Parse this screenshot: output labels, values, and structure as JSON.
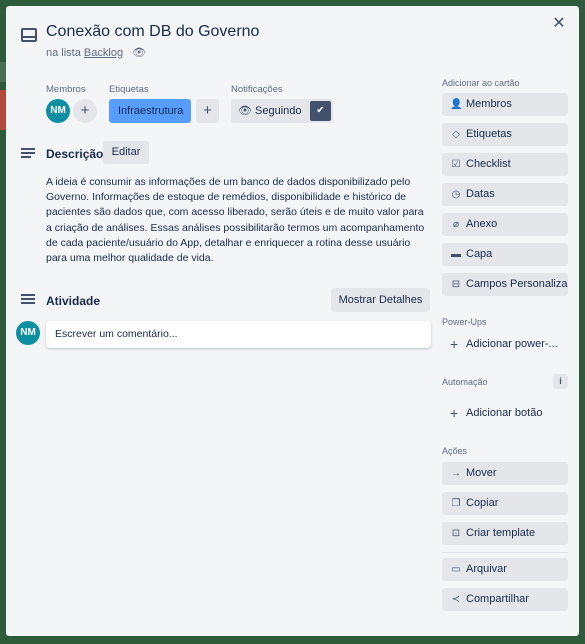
{
  "card": {
    "title": "Conexão com DB do Governo",
    "list_prefix": "na lista",
    "list_name": "Backlog"
  },
  "members": {
    "label": "Membros",
    "avatar_initials": "NM"
  },
  "labels": {
    "label": "Etiquetas",
    "chip": "Infraestrutura",
    "chip_color": "#579dff"
  },
  "notifications": {
    "label": "Notificações",
    "status": "Seguindo"
  },
  "description": {
    "title": "Descrição",
    "edit_label": "Editar",
    "text": "A ideia é consumir as informações de um banco de dados disponibilizado pelo Governo. Informações de estoque de remédios, disponibilidade e histórico de pacientes são dados que, com acesso liberado, serão úteis e de muito valor para a criação de análises. Essas análises possibilitarão termos um acompanhamento de cada paciente/usuário do App, detalhar e enriquecer a rotina desse usuário para uma melhor qualidade de vida."
  },
  "activity": {
    "title": "Atividade",
    "details_label": "Mostrar Detalhes",
    "avatar_initials": "NM",
    "comment_placeholder": "Escrever um comentário..."
  },
  "sidebar": {
    "add_heading": "Adicionar ao cartão",
    "add_items": [
      {
        "label": "Membros",
        "icon": "person-icon"
      },
      {
        "label": "Etiquetas",
        "icon": "tag-icon"
      },
      {
        "label": "Checklist",
        "icon": "checklist-icon"
      },
      {
        "label": "Datas",
        "icon": "clock-icon"
      },
      {
        "label": "Anexo",
        "icon": "paperclip-icon"
      },
      {
        "label": "Capa",
        "icon": "cover-icon"
      },
      {
        "label": "Campos Personaliza...",
        "icon": "custom-fields-icon"
      }
    ],
    "powerups_heading": "Power-Ups",
    "powerups_add": "Adicionar power-...",
    "automation_heading": "Automação",
    "automation_add": "Adicionar botão",
    "actions_heading": "Ações",
    "actions": [
      {
        "label": "Mover",
        "icon": "arrow-right-icon"
      },
      {
        "label": "Copiar",
        "icon": "copy-icon"
      },
      {
        "label": "Criar template",
        "icon": "template-icon"
      }
    ],
    "actions_extra": [
      {
        "label": "Arquivar",
        "icon": "archive-icon"
      },
      {
        "label": "Compartilhar",
        "icon": "share-icon"
      }
    ]
  },
  "colors": {
    "modal_bg": "#f4f5f7",
    "board_bg": "#2e5b3a",
    "button_bg": "#e4e6ea",
    "avatar": "#0c8fa3"
  }
}
